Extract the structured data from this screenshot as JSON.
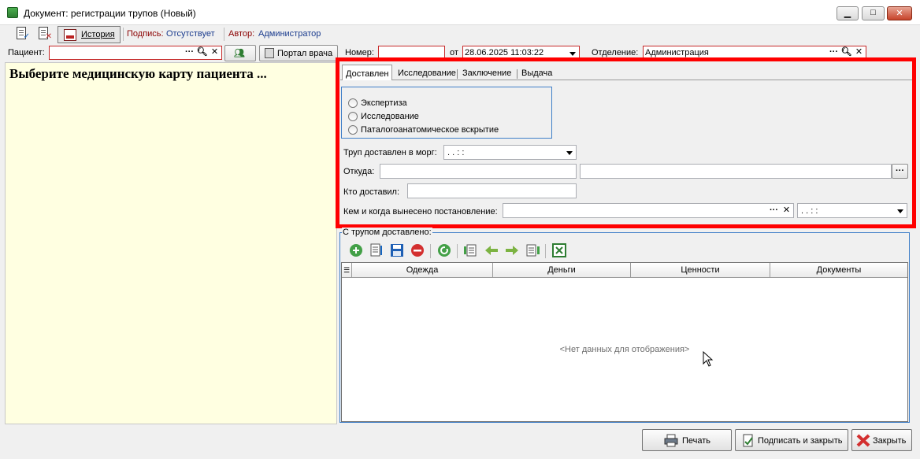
{
  "window": {
    "title": "Документ: регистрации трупов (Новый)",
    "min_glyph": "▁",
    "max_glyph": "□",
    "close_glyph": "✕"
  },
  "toolbar": {
    "history_label": "История",
    "signature_label": "Подпись:",
    "signature_value": "Отсутствует",
    "author_label": "Автор:",
    "author_value": "Администратор"
  },
  "header": {
    "patient_label": "Пациент:",
    "patient_value": "",
    "doctor_portal_label": "Портал врача",
    "number_label": "Номер:",
    "number_value": "",
    "date_from_label": "от",
    "date_value": "28.06.2025 11:03:22",
    "department_label": "Отделение:",
    "department_value": "Администрация"
  },
  "left_panel": {
    "message": "Выберите медицинскую карту пациента ..."
  },
  "tabs": [
    {
      "label": "Доставлен"
    },
    {
      "label": "Исследование"
    },
    {
      "label": "Заключение"
    },
    {
      "label": "Выдача"
    }
  ],
  "delivered": {
    "radio_options": [
      "Экспертиза",
      "Исследование",
      "Паталогоанатомическое вскрытие"
    ],
    "delivered_to_morgue_label": "Труп доставлен в морг:",
    "delivered_to_morgue_value": " .  .      :  :",
    "from_label": "Откуда:",
    "from_value_1": "",
    "from_value_2": "",
    "delivered_by_label": "Кто доставил:",
    "delivered_by_value": "",
    "decree_label": "Кем и когда вынесено постановление:",
    "decree_value": "",
    "decree_date_value": " .  .      :  :"
  },
  "items_group": {
    "title": "С трупом доставлено:",
    "columns": [
      "Одежда",
      "Деньги",
      "Ценности",
      "Документы"
    ],
    "empty_text": "<Нет данных для отображения>"
  },
  "bottom": {
    "print_label": "Печать",
    "sign_close_label": "Подписать и закрыть",
    "close_label": "Закрыть"
  },
  "colors": {
    "highlight": "#ff0000",
    "panel_yellow": "#ffffe1",
    "link_blue": "#1b3c8e",
    "label_red": "#8b0000"
  }
}
